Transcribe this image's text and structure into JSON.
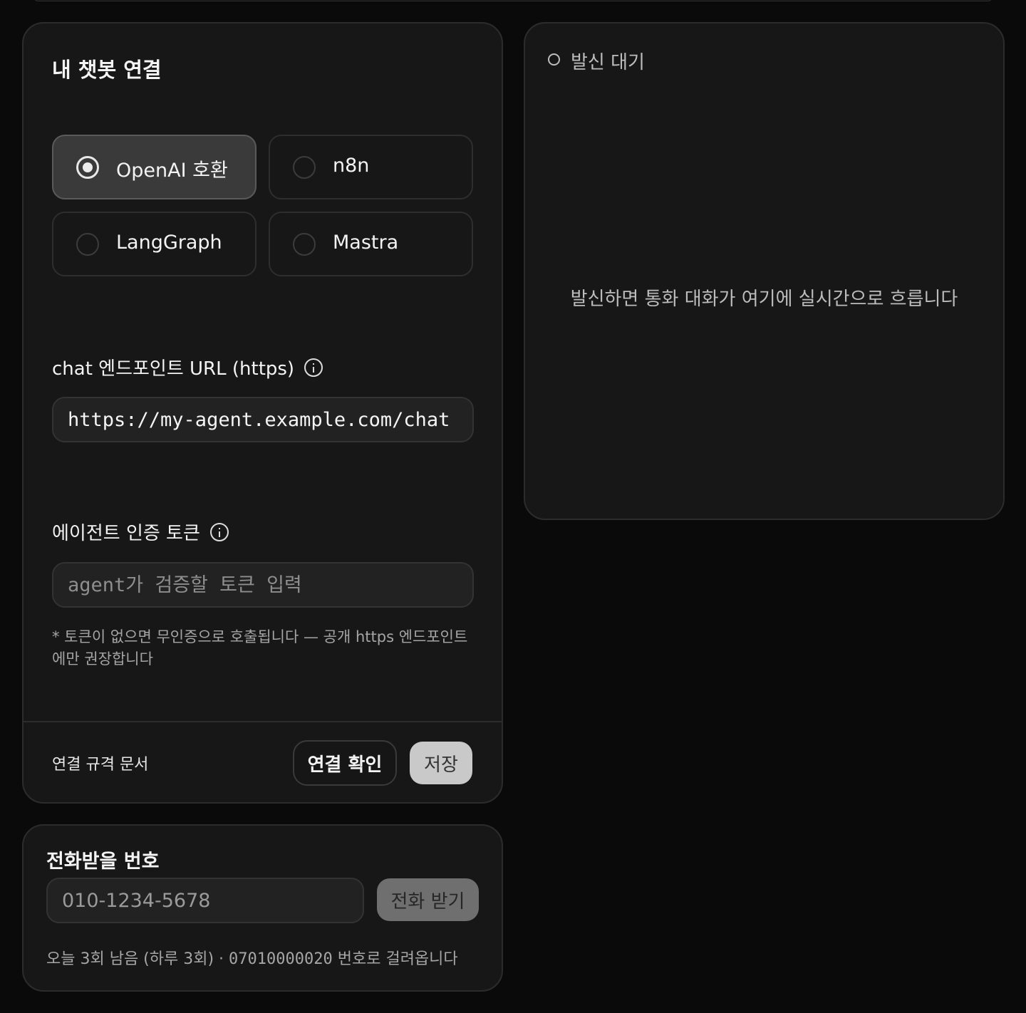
{
  "connect": {
    "title": "내 챗봇 연결",
    "options": [
      {
        "label": "OpenAI 호환",
        "selected": true
      },
      {
        "label": "n8n",
        "selected": false
      },
      {
        "label": "LangGraph",
        "selected": false
      },
      {
        "label": "Mastra",
        "selected": false
      }
    ],
    "url_label": "chat 엔드포인트 URL (https)",
    "url_value": "https://my-agent.example.com/chat",
    "token_label": "에이전트 인증 토큰",
    "token_placeholder": "agent가 검증할 토큰 입력",
    "note": "* 토큰이 없으면 무인증으로 호출됩니다 — 공개 https 엔드포인트에만 권장합니다",
    "spec_link": "연결 규격 문서",
    "test_button": "연결 확인",
    "save_button": "저장"
  },
  "status": {
    "label": "발신 대기",
    "empty_message": "발신하면 통화 대화가 여기에 실시간으로 흐릅니다"
  },
  "phone": {
    "title": "전화받을 번호",
    "placeholder": "010-1234-5678",
    "call_button": "전화 받기",
    "quota_prefix": "오늘 3회 남음 (하루 3회) · ",
    "caller_number": "07010000020",
    "quota_suffix": " 번호로 걸려옵니다"
  }
}
